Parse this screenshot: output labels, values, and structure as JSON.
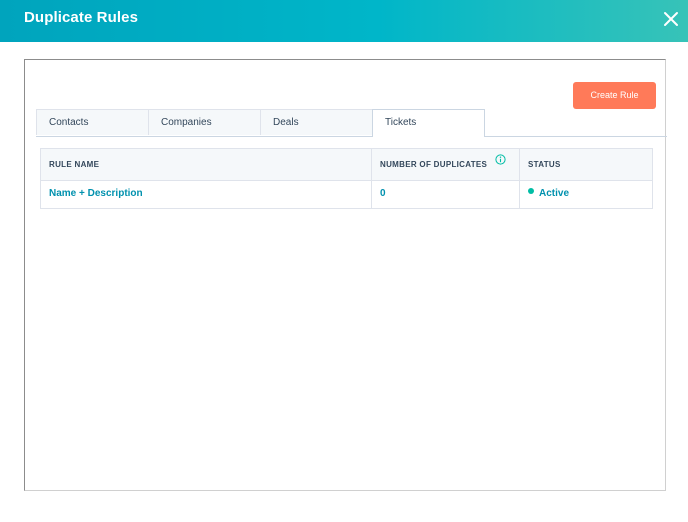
{
  "dialog": {
    "title": "Duplicate Rules"
  },
  "toolbar": {
    "create_label": "Create Rule"
  },
  "tabs": [
    {
      "label": "Contacts"
    },
    {
      "label": "Companies"
    },
    {
      "label": "Deals"
    },
    {
      "label": "Tickets",
      "active": true
    }
  ],
  "table": {
    "headers": [
      "RULE NAME",
      "NUMBER OF DUPLICATES",
      "STATUS"
    ],
    "rows": [
      {
        "name": "Name + Description",
        "duplicates": "0",
        "status": "Active"
      }
    ]
  },
  "colors": {
    "header_gradient_start": "#00a4bd",
    "header_gradient_end": "#37c3b8",
    "create_button": "#ff7a59",
    "link": "#0091ae",
    "status_active": "#00bda5",
    "info_icon": "#00bda5"
  },
  "icons": {
    "close": "close-icon",
    "info": "info-icon",
    "status": "status-dot-icon"
  }
}
